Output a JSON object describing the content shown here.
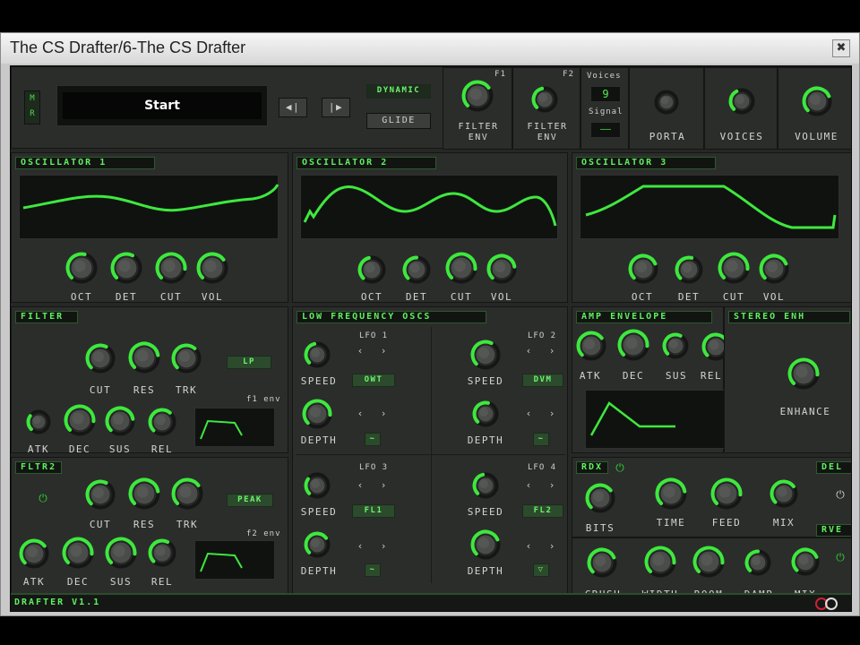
{
  "window": {
    "title": "The CS Drafter/6-The CS Drafter",
    "close_glyph": "✖"
  },
  "top": {
    "mode_letters": [
      "M",
      "R"
    ],
    "preset_name": "Start",
    "nav_prev": "◀|",
    "nav_next": "|▶",
    "dynamic_label": "DYNAMIC",
    "glide_label": "GLIDE",
    "filter_env_f1_tag": "F1",
    "filter_env_f2_tag": "F2",
    "filter_env_label": "FILTER ENV",
    "voices_label": "Voices",
    "voices_value": "9",
    "signal_label": "Signal",
    "signal_value": "——",
    "porta_label": "PORTA",
    "voices_knob_label": "VOICES",
    "volume_label": "VOLUME"
  },
  "oscillators": [
    {
      "title": "OSCILLATOR 1",
      "knobs": [
        "OCT",
        "DET",
        "CUT",
        "VOL"
      ],
      "values": [
        0.55,
        0.6,
        0.85,
        0.7
      ]
    },
    {
      "title": "OSCILLATOR 2",
      "knobs": [
        "OCT",
        "DET",
        "CUT",
        "VOL"
      ],
      "values": [
        0.45,
        0.5,
        0.85,
        0.8
      ]
    },
    {
      "title": "OSCILLATOR 3",
      "knobs": [
        "OCT",
        "DET",
        "CUT",
        "VOL"
      ],
      "values": [
        0.75,
        0.55,
        0.85,
        0.75
      ]
    }
  ],
  "filter": {
    "title": "FILTER",
    "knobs_top": [
      "CUT",
      "RES",
      "TRK"
    ],
    "knobs_top_values": [
      0.6,
      0.8,
      0.65
    ],
    "mode": "LP",
    "env_tag": "f1 env",
    "knobs_bottom": [
      "ATK",
      "DEC",
      "SUS",
      "REL"
    ],
    "knobs_bottom_values": [
      0.3,
      0.85,
      0.8,
      0.65
    ]
  },
  "filter2": {
    "title": "FLTR2",
    "power": "⏻",
    "knobs_top": [
      "CUT",
      "RES",
      "TRK"
    ],
    "knobs_top_values": [
      0.6,
      0.8,
      0.7
    ],
    "mode": "PEAK",
    "env_tag": "f2 env",
    "knobs_bottom": [
      "ATK",
      "DEC",
      "SUS",
      "REL"
    ],
    "knobs_bottom_values": [
      0.7,
      0.85,
      0.85,
      0.6
    ]
  },
  "lfo": {
    "title": "LOW FREQUENCY OSCS",
    "units": [
      {
        "name": "LFO 1",
        "speed": "SPEED",
        "depth": "DEPTH",
        "target": "OWT",
        "wave": "~",
        "speed_value": 0.45,
        "depth_value": 0.85
      },
      {
        "name": "LFO 2",
        "speed": "SPEED",
        "depth": "DEPTH",
        "target": "DVM",
        "wave": "~",
        "speed_value": 0.6,
        "depth_value": 0.55
      },
      {
        "name": "LFO 3",
        "speed": "SPEED",
        "depth": "DEPTH",
        "target": "FL1",
        "wave": "~",
        "speed_value": 0.3,
        "depth_value": 0.7
      },
      {
        "name": "LFO 4",
        "speed": "SPEED",
        "depth": "DEPTH",
        "target": "FL2",
        "wave": "▽",
        "speed_value": 0.45,
        "depth_value": 0.75
      }
    ],
    "arrow_left": "‹",
    "arrow_right": "›"
  },
  "amp_env": {
    "title": "AMP ENVELOPE",
    "knobs": [
      "ATK",
      "DEC",
      "SUS",
      "REL"
    ],
    "values": [
      0.7,
      0.85,
      0.6,
      0.7
    ]
  },
  "stereo": {
    "title": "STEREO ENH",
    "knob": "ENHANCE",
    "value": 0.85
  },
  "rdx": {
    "title": "RDX",
    "power": "⏻",
    "row1": [
      "BITS"
    ],
    "row1_values": [
      0.7
    ],
    "row2": [
      "CRUSH"
    ],
    "row2_values": [
      0.75
    ]
  },
  "delay": {
    "title": "DEL",
    "knobs": [
      "TIME",
      "FEED",
      "MIX"
    ],
    "values": [
      0.8,
      0.85,
      0.7
    ]
  },
  "reverb": {
    "title": "RVE",
    "knobs": [
      "WIDTH",
      "ROOM",
      "DAMP",
      "MIX"
    ],
    "values": [
      0.85,
      0.85,
      0.5,
      0.75
    ]
  },
  "footer": {
    "version": "DRAFTER V1.1"
  },
  "colors": {
    "accent": "#3ee83e",
    "panel": "#2b2d2b",
    "background": "#262826",
    "lcd": "#101210"
  }
}
